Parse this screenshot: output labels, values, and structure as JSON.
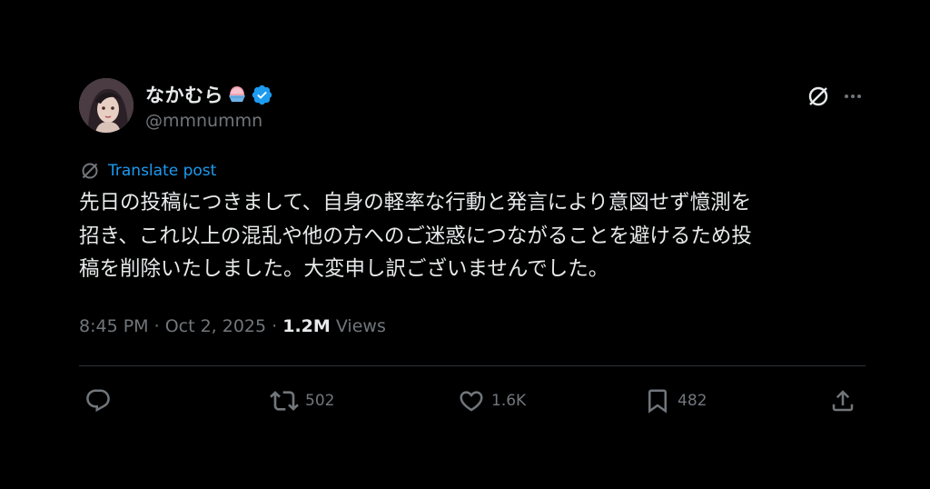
{
  "author": {
    "display_name": "なかむら",
    "name_emoji": "shaved-ice-emoji",
    "verified": true,
    "handle": "@mmnummn"
  },
  "translate": {
    "label": "Translate post"
  },
  "post": {
    "lines": [
      "先日の投稿につきまして、自身の軽率な行動と発言により意図せず憶測を",
      "招き、これ以上の混乱や他の方へのご迷惑につながることを避けるため投",
      "稿を削除いたしました。大変申し訳ございませんでした。"
    ]
  },
  "meta": {
    "time": "8:45 PM",
    "separator": " · ",
    "date": "Oct 2, 2025",
    "views_count": "1.2M",
    "views_label": " Views"
  },
  "actions": {
    "reply": {
      "icon": "reply-icon",
      "count": ""
    },
    "repost": {
      "icon": "repost-icon",
      "count": "502"
    },
    "like": {
      "icon": "heart-icon",
      "count": "1.6K"
    },
    "bookmark": {
      "icon": "bookmark-icon",
      "count": "482"
    },
    "share": {
      "icon": "share-icon",
      "count": ""
    }
  },
  "colors": {
    "background": "#000000",
    "text": "#e7e9ea",
    "muted": "#71767b",
    "link": "#1d9bf0",
    "verified": "#1d9bf0",
    "divider": "#2f3336"
  }
}
